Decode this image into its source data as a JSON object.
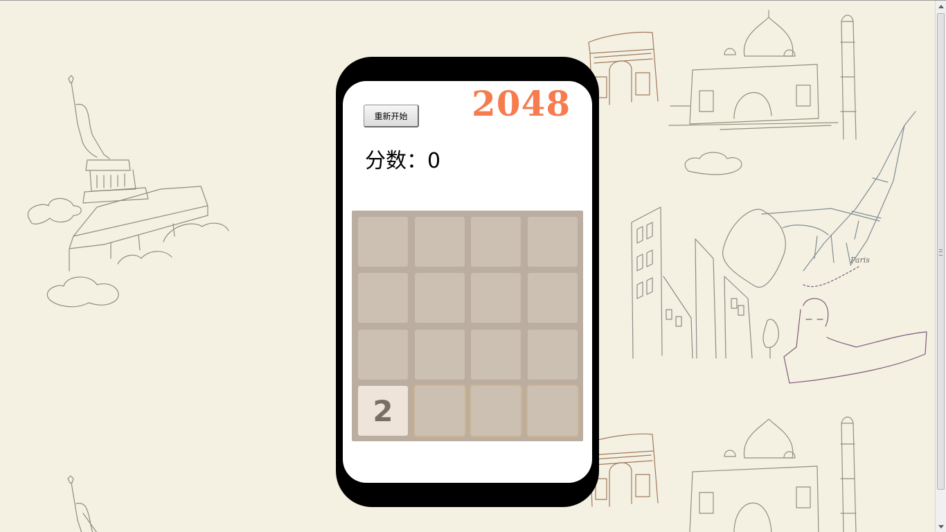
{
  "game": {
    "title": "2048",
    "restart_label": "重新开始",
    "score_label": "分数：",
    "score_value": "0"
  },
  "board": {
    "rows": 4,
    "cols": 4,
    "cells": [
      [
        "",
        "",
        "",
        ""
      ],
      [
        "",
        "",
        "",
        ""
      ],
      [
        "",
        "",
        "",
        ""
      ],
      [
        "2",
        "",
        "",
        ""
      ]
    ]
  },
  "colors": {
    "page_background": "#f4f1e3",
    "title": "#f67c4f",
    "board_background": "#bbada0",
    "empty_cell": "#ccc0b3",
    "tile_2": "#eee4da",
    "tile_text": "#776e65",
    "phone_frame": "#000000",
    "phone_screen": "#ffffff"
  },
  "background_art": {
    "landmarks": [
      "statue-of-liberty",
      "arc-de-triomphe",
      "taj-mahal",
      "eiffel-tower",
      "city-buildings",
      "sphinx"
    ],
    "paris_text": "Paris"
  }
}
